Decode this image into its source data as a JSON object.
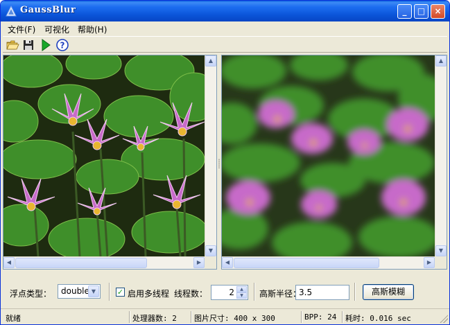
{
  "window": {
    "title": "GaussBlur",
    "controls": {
      "minimize": "_",
      "maximize": "□",
      "close": "×"
    }
  },
  "menu": {
    "file": "文件(F)",
    "visualize": "可视化",
    "help": "帮助(H)"
  },
  "toolbar": {
    "open_icon": "folder-open-icon",
    "save_icon": "floppy-disk-icon",
    "run_icon": "play-icon",
    "help_icon": "help-icon"
  },
  "panes": {
    "left": {
      "content": "original-water-lily-photo"
    },
    "right": {
      "content": "blurred-water-lily-photo"
    }
  },
  "controls": {
    "float_type_label": "浮点类型：",
    "float_type_value": "double",
    "multithread_label": "启用多线程",
    "multithread_checked": true,
    "threads_label": "线程数：",
    "threads_value": "2",
    "radius_label": "高斯半径：",
    "radius_value": "3.5",
    "blur_button": "高斯模糊"
  },
  "status": {
    "ready": "就绪",
    "processors": "处理器数: 2",
    "image_size": "图片尺寸: 400 x 300",
    "bpp": "BPP: 24",
    "elapsed": "耗时: 0.016 sec"
  },
  "colors": {
    "title_bar": "#0a54d8",
    "window_face": "#ece9d8",
    "border": "#7f9db9"
  }
}
